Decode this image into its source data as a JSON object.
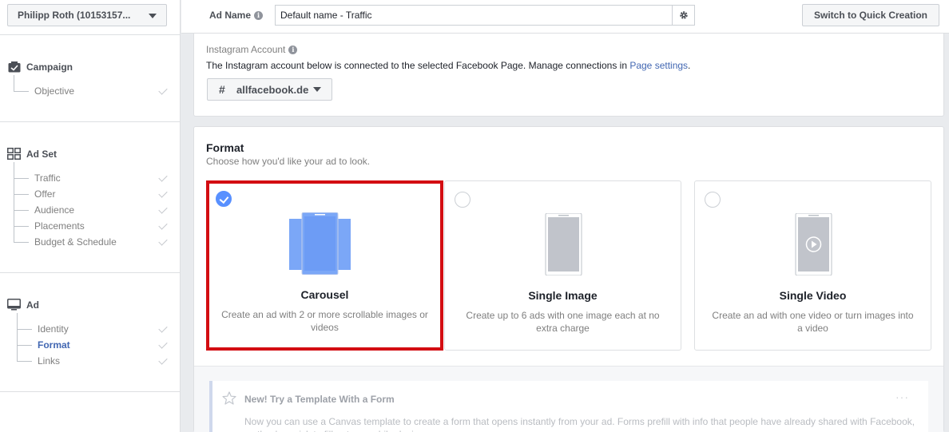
{
  "sidebar": {
    "account": "Philipp Roth (10153157...",
    "campaign": {
      "title": "Campaign",
      "items": [
        {
          "label": "Objective"
        }
      ]
    },
    "adset": {
      "title": "Ad Set",
      "items": [
        {
          "label": "Traffic"
        },
        {
          "label": "Offer"
        },
        {
          "label": "Audience"
        },
        {
          "label": "Placements"
        },
        {
          "label": "Budget & Schedule"
        }
      ]
    },
    "ad": {
      "title": "Ad",
      "items": [
        {
          "label": "Identity"
        },
        {
          "label": "Format"
        },
        {
          "label": "Links"
        }
      ],
      "active": "Format"
    }
  },
  "topbar": {
    "ad_name_label": "Ad Name",
    "ad_name_value": "Default name - Traffic",
    "quick_creation": "Switch to Quick Creation"
  },
  "instagram": {
    "title": "Instagram Account",
    "description": "The Instagram account below is connected to the selected Facebook Page. Manage connections in ",
    "link": "Page settings",
    "after_link": ".",
    "account": "allfacebook.de"
  },
  "format": {
    "title": "Format",
    "subtitle": "Choose how you'd like your ad to look.",
    "options": [
      {
        "name": "Carousel",
        "description": "Create an ad with 2 or more scrollable images or videos",
        "selected": true
      },
      {
        "name": "Single Image",
        "description": "Create up to 6 ads with one image each at no extra charge",
        "selected": false
      },
      {
        "name": "Single Video",
        "description": "Create an ad with one video or turn images into a video",
        "selected": false
      }
    ]
  },
  "tip": {
    "title": "New! Try a Template With a Form",
    "text": "Now you can use a Canvas template to create a form that opens instantly from your ad. Forms prefill with info that people have already shared with Facebook, so they're quick to fill out on mobile devices.",
    "more": "···"
  },
  "colors": {
    "accent": "#4267b2",
    "selection_border": "#d30d12",
    "radio_selected": "#5890ff",
    "carousel_fill": "#7ba7f7"
  }
}
